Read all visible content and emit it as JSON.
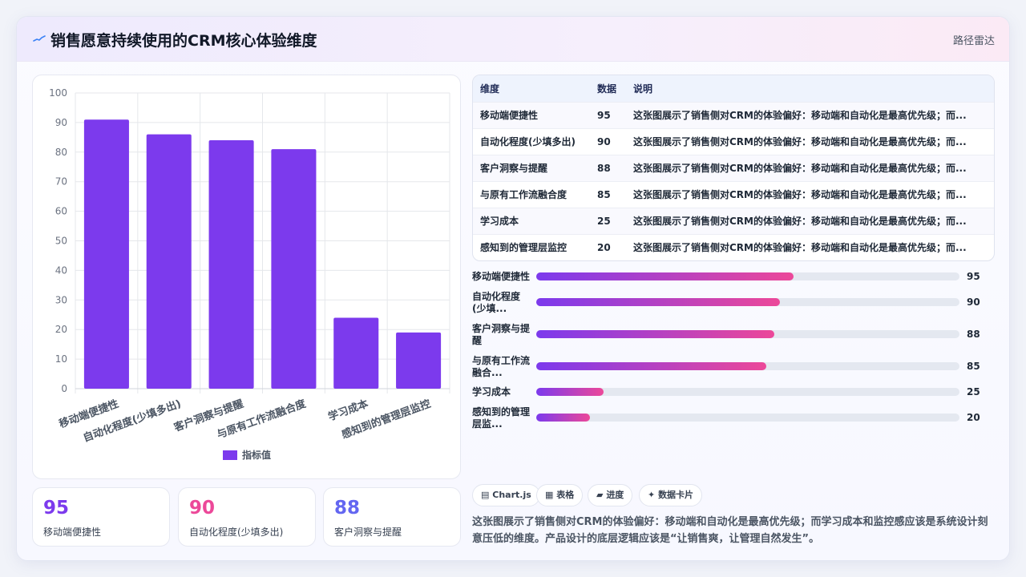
{
  "header": {
    "title": "销售愿意持续使用的CRM核心体验维度",
    "right_label": "路径雷达"
  },
  "colors": {
    "bar": "#7c3aed",
    "accent_purple": "#7c3aed",
    "accent_pink": "#ec4899",
    "accent_indigo": "#6366f1"
  },
  "chart_data": {
    "type": "bar",
    "categories": [
      "移动端便捷性",
      "自动化程度(少填多出)",
      "客户洞察与提醒",
      "与原有工作流融合度",
      "学习成本",
      "感知到的管理层监控"
    ],
    "series": [
      {
        "name": "指标值",
        "values": [
          91,
          86,
          84,
          81,
          24,
          19
        ]
      }
    ],
    "ylim": [
      0,
      100
    ],
    "yticks": [
      0,
      10,
      20,
      30,
      40,
      50,
      60,
      70,
      80,
      90,
      100
    ],
    "grid": true,
    "legend": "bottom"
  },
  "stats": [
    {
      "value": "95",
      "label": "移动端便捷性",
      "color": "#7c3aed"
    },
    {
      "value": "90",
      "label": "自动化程度(少填多出)",
      "color": "#ec4899"
    },
    {
      "value": "88",
      "label": "客户洞察与提醒",
      "color": "#6366f1"
    }
  ],
  "table": {
    "headers": [
      "维度",
      "数据",
      "说明"
    ],
    "rows": [
      {
        "dim": "移动端便捷性",
        "value": "95",
        "desc": "这张图展示了销售侧对CRM的体验偏好：移动端和自动化是最高优先级；而..."
      },
      {
        "dim": "自动化程度(少填多出)",
        "value": "90",
        "desc": "这张图展示了销售侧对CRM的体验偏好：移动端和自动化是最高优先级；而..."
      },
      {
        "dim": "客户洞察与提醒",
        "value": "88",
        "desc": "这张图展示了销售侧对CRM的体验偏好：移动端和自动化是最高优先级；而..."
      },
      {
        "dim": "与原有工作流融合度",
        "value": "85",
        "desc": "这张图展示了销售侧对CRM的体验偏好：移动端和自动化是最高优先级；而..."
      },
      {
        "dim": "学习成本",
        "value": "25",
        "desc": "这张图展示了销售侧对CRM的体验偏好：移动端和自动化是最高优先级；而..."
      },
      {
        "dim": "感知到的管理层监控",
        "value": "20",
        "desc": "这张图展示了销售侧对CRM的体验偏好：移动端和自动化是最高优先级；而..."
      }
    ]
  },
  "progress": [
    {
      "label": "移动端便捷性",
      "value": 95,
      "value_text": "95",
      "fill_fraction": 0.608
    },
    {
      "label": "自动化程度(少填...",
      "value": 90,
      "value_text": "90",
      "fill_fraction": 0.576
    },
    {
      "label": "客户洞察与提醒",
      "value": 88,
      "value_text": "88",
      "fill_fraction": 0.563
    },
    {
      "label": "与原有工作流融合...",
      "value": 85,
      "value_text": "85",
      "fill_fraction": 0.544
    },
    {
      "label": "学习成本",
      "value": 25,
      "value_text": "25",
      "fill_fraction": 0.159
    },
    {
      "label": "感知到的管理层监...",
      "value": 20,
      "value_text": "20",
      "fill_fraction": 0.127
    }
  ],
  "chips": [
    {
      "icon": "▤",
      "label": "Chart.js"
    },
    {
      "icon": "▦",
      "label": "表格"
    },
    {
      "icon": "▰",
      "label": "进度"
    },
    {
      "icon": "✦",
      "label": "数据卡片"
    }
  ],
  "summary": "这张图展示了销售侧对CRM的体验偏好：移动端和自动化是最高优先级；而学习成本和监控感应该是系统设计刻意压低的维度。产品设计的底层逻辑应该是“让销售爽，让管理自然发生”。"
}
